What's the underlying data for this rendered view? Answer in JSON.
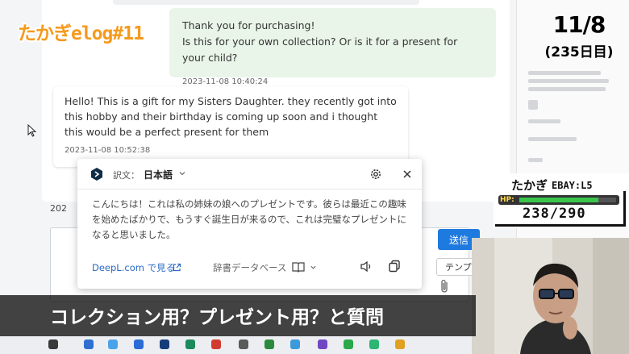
{
  "chat": {
    "my_message": {
      "line1": "Thank you for purchasing!",
      "line2": "Is this for your own collection? Or is it for a present for your child?",
      "timestamp": "2023-11-08 10:40:24"
    },
    "buyer_message": {
      "text": "Hello! This is a gift for my Sisters Daughter. they recently got into this hobby and their birthday is coming up soon and i thought this would be a perfect present for them",
      "timestamp": "2023-11-08 10:52:38"
    },
    "date_stub": "202",
    "send_label": "送信",
    "template_label": "テンプ"
  },
  "deepl": {
    "translation_label": "訳文：",
    "target_language": "日本語",
    "translated_text": "こんにちは！これは私の姉妹の娘へのプレゼントです。彼らは最近この趣味を始めたばかりで、もうすぐ誕生日が来るので、これは完璧なプレゼントになると思いました。",
    "open_link": "DeepL.com で見る",
    "dictionary_label": "辞書データベース",
    "colors": {
      "link": "#2a69c6",
      "logo": "#0f2b46"
    }
  },
  "overlay": {
    "brand": "たかぎelog#11",
    "date": "11/8",
    "day_count": "(235日目)",
    "status": {
      "name": "たかぎ",
      "level": "EBAY:L5",
      "hp_tag": "HP:",
      "hp_current": 238,
      "hp_max": 290,
      "hp_text": "238/290"
    },
    "caption": "コレクション用？プレゼント用？と質問",
    "colors": {
      "brand": "#f59a1e",
      "hp_fill": "#39c64b",
      "send": "#1f7ae0"
    }
  }
}
